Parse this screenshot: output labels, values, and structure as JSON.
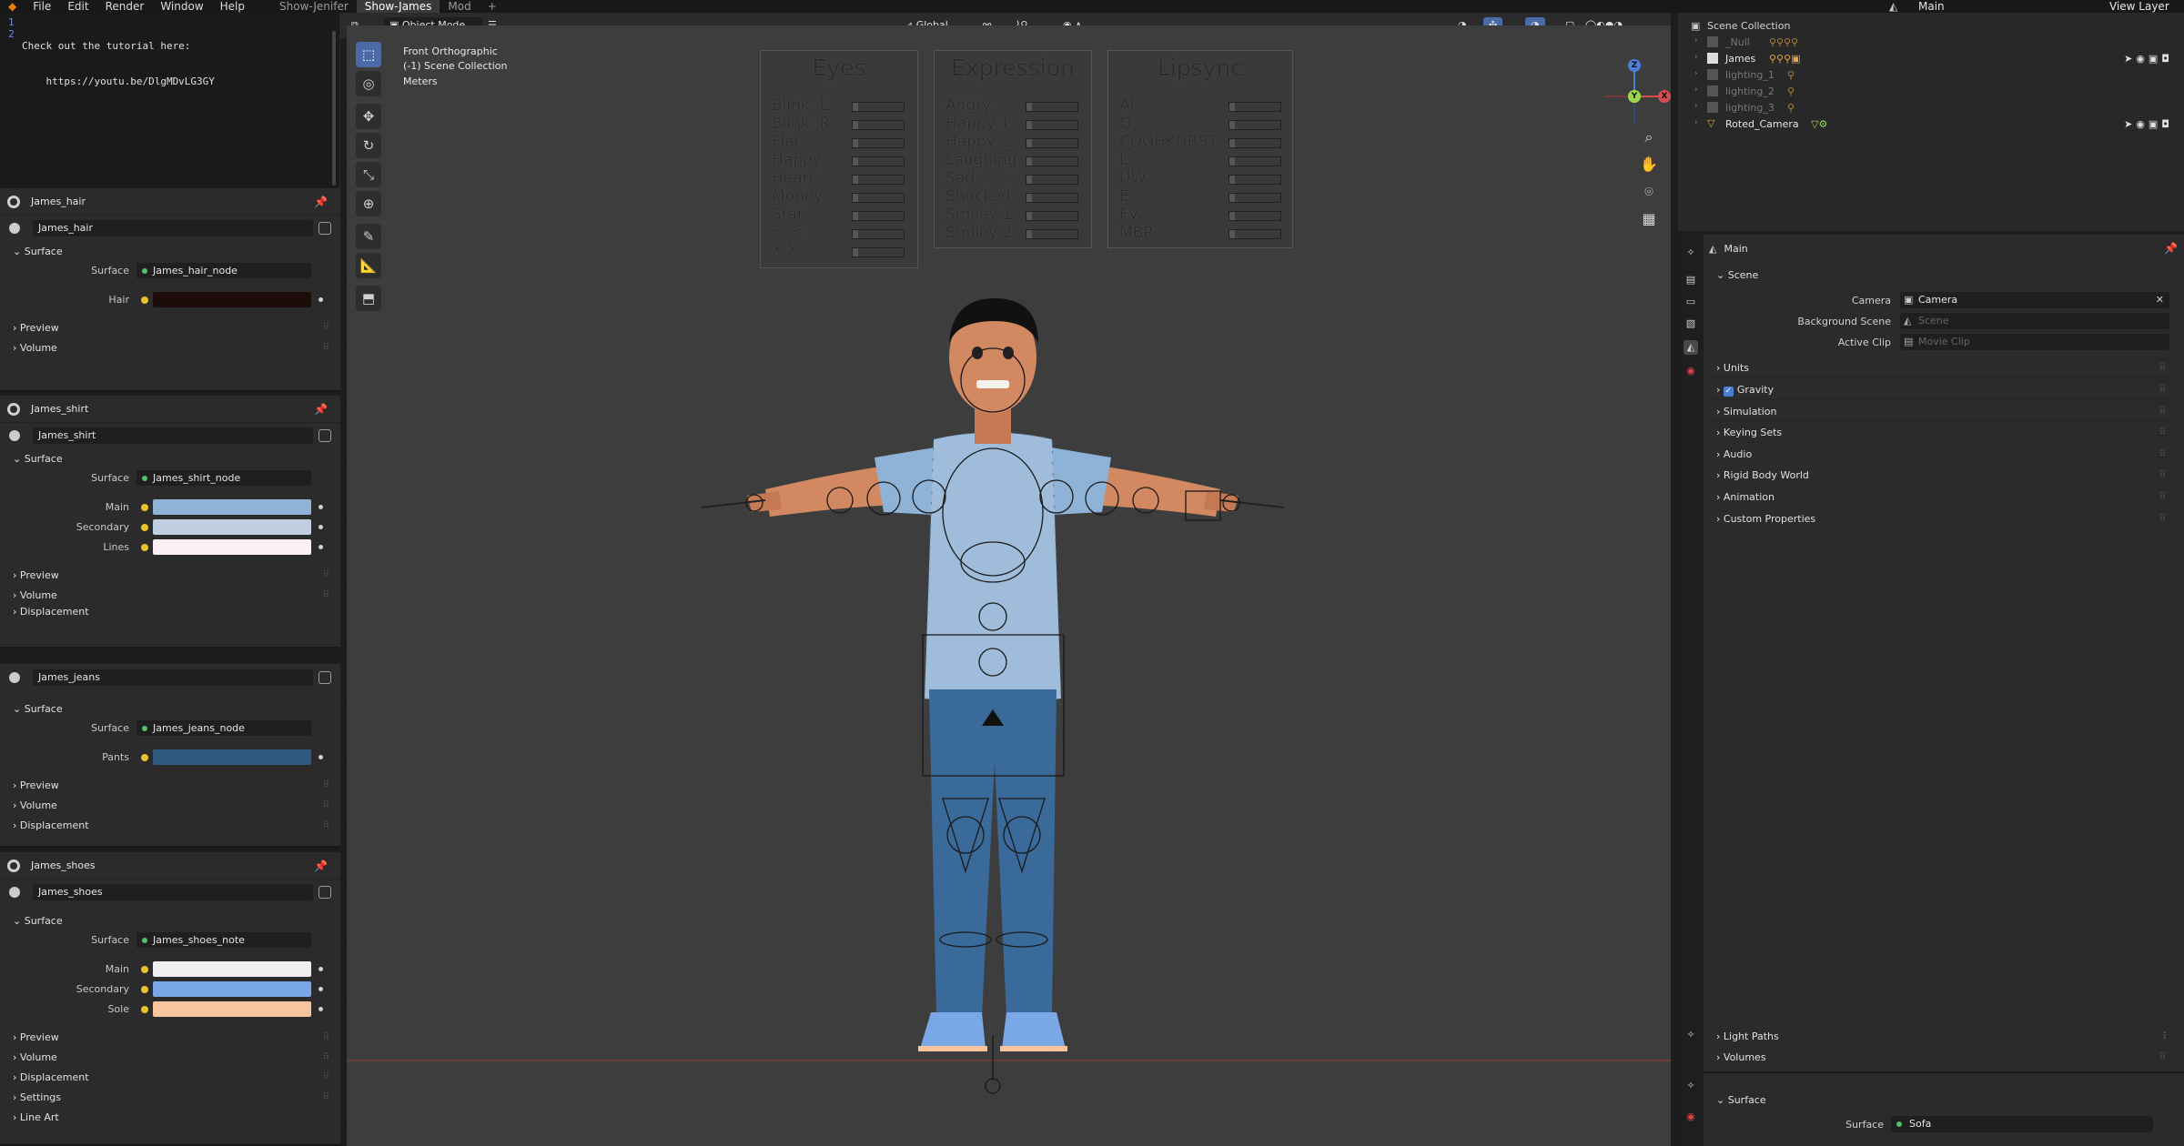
{
  "menu": {
    "items": [
      "File",
      "Edit",
      "Render",
      "Window",
      "Help"
    ]
  },
  "workspaces": [
    "Show-Jenifer",
    "Show-James",
    "Mod",
    "+"
  ],
  "topright": {
    "scene": "Main",
    "view_layer": "View Layer"
  },
  "text_editor": {
    "line_numbers": [
      "1",
      "2"
    ],
    "lines": [
      "Check out the tutorial here:",
      "    https://youtu.be/DlgMDvLG3GY"
    ]
  },
  "viewport": {
    "mode": "Object Mode",
    "orientation": "Global",
    "info": [
      "Front Orthographic",
      "(-1) Scene Collection",
      "Meters"
    ],
    "boards": {
      "eyes": {
        "title": "Eyes",
        "rows": [
          "Blink .L",
          "Blink .R",
          "Flat",
          "Happy",
          "Heart",
          "Money",
          "Star",
          "> <",
          "X X"
        ]
      },
      "expression": {
        "title": "Expression",
        "rows": [
          "Angry",
          "Happy 1",
          "Happy 2",
          "Laughing",
          "Sad",
          "Shocked",
          "Smiley 1",
          "Smiley 2"
        ]
      },
      "lipsync": {
        "title": "Lipsync",
        "rows": [
          "AI",
          "O",
          "CDGHKNRST",
          "L",
          "UW",
          "E",
          "FV",
          "MBP"
        ]
      }
    },
    "gizmo": {
      "x": "X",
      "y": "Y",
      "z": "Z"
    }
  },
  "materials": [
    {
      "name": "James_hair",
      "slot": "James_hair",
      "surface": "Surface",
      "node": "James_hair_node",
      "props": [
        {
          "label": "Hair",
          "color": "#1e0c0a"
        }
      ],
      "sections": [
        "Preview",
        "Volume"
      ]
    },
    {
      "name": "James_shirt",
      "slot": "James_shirt",
      "surface": "Surface",
      "node": "James_shirt_node",
      "props": [
        {
          "label": "Main",
          "color": "#8fb3d6"
        },
        {
          "label": "Secondary",
          "color": "#c2cfe0"
        },
        {
          "label": "Lines",
          "color": "#fbf0f5"
        }
      ],
      "sections": [
        "Preview",
        "Volume",
        "Displacement"
      ]
    },
    {
      "name": "",
      "slot": "James_jeans",
      "surface": "Surface",
      "node": "James_jeans_node",
      "props": [
        {
          "label": "Pants",
          "color": "#2f5a7d"
        }
      ],
      "sections": [
        "Preview",
        "Volume",
        "Displacement"
      ]
    },
    {
      "name": "James_shoes",
      "slot": "James_shoes",
      "surface": "Surface",
      "node": "James_shoes_note",
      "props": [
        {
          "label": "Main",
          "color": "#f0f0f0"
        },
        {
          "label": "Secondary",
          "color": "#7aa7e6"
        },
        {
          "label": "Sole",
          "color": "#f9c59e"
        }
      ],
      "sections": [
        "Preview",
        "Volume",
        "Displacement",
        "Settings",
        "Line Art"
      ]
    }
  ],
  "outliner": {
    "title": "Scene Collection",
    "items": [
      {
        "name": "_Null",
        "dim": true
      },
      {
        "name": "James",
        "dim": false
      },
      {
        "name": "lighting_1",
        "dim": true
      },
      {
        "name": "lighting_2",
        "dim": true
      },
      {
        "name": "lighting_3",
        "dim": true
      },
      {
        "name": "Roted_Camera",
        "dim": false
      }
    ]
  },
  "properties": {
    "context": "Main",
    "scene_section": "Scene",
    "camera_label": "Camera",
    "camera_value": "Camera",
    "bg_label": "Background Scene",
    "bg_placeholder": "Scene",
    "clip_label": "Active Clip",
    "clip_placeholder": "Movie Clip",
    "sections": [
      "Units",
      "Gravity",
      "Simulation",
      "Keying Sets",
      "Audio",
      "Rigid Body World",
      "Animation",
      "Custom Properties"
    ],
    "lower_sections": [
      "Light Paths",
      "Volumes"
    ],
    "world_surface": "Surface",
    "world_surface_label": "Surface",
    "world_surface_value": "Sofa"
  }
}
